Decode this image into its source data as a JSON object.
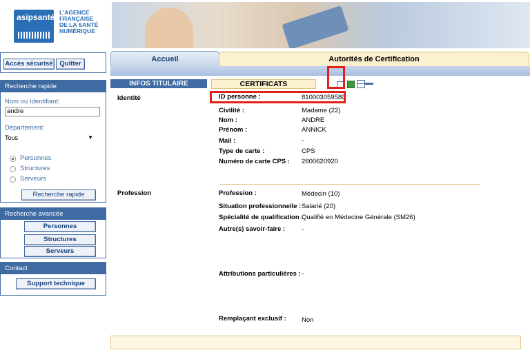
{
  "header": {
    "logo_text": "asipsanté",
    "agency_lines": [
      "L'AGENCE",
      "FRANÇAISE",
      "DE LA SANTÉ",
      "NUMÉRIQUE"
    ]
  },
  "sidebar": {
    "secure_access": "Accès sécurisé",
    "quit": "Quitter",
    "quick_search": {
      "title": "Recherche rapide",
      "name_label": "Nom ou Identifiant:",
      "name_value": "andre",
      "dept_label": "Département:",
      "dept_value": "Tous",
      "radios": [
        "Personnes",
        "Structures",
        "Serveurs"
      ],
      "selected": "Personnes",
      "button": "Recherche rapide"
    },
    "advanced_search": {
      "title": "Recherche avancée",
      "buttons": [
        "Personnes",
        "Structures",
        "Serveurs"
      ]
    },
    "contact": {
      "title": "Contact",
      "button": "Support technique"
    }
  },
  "tabs": {
    "home": "Accueil",
    "authorities": "Autorités de Certification",
    "infos": "INFOS TITULAIRE",
    "certs": "CERTIFICATS"
  },
  "identity": {
    "section": "Identité",
    "rows": [
      {
        "label": "ID personne :",
        "value": "810003059580"
      },
      {
        "label": "Civilité :",
        "value": "Madame (22)"
      },
      {
        "label": "Nom :",
        "value": "ANDRE"
      },
      {
        "label": "Prénom :",
        "value": "ANNICK"
      },
      {
        "label": "Mail :",
        "value": "-"
      },
      {
        "label": "Type de carte :",
        "value": "CPS"
      },
      {
        "label": "Numéro de carte CPS :",
        "value": "2600620920"
      }
    ]
  },
  "profession": {
    "section": "Profession",
    "rows": [
      {
        "label": "Profession :",
        "value": "Médecin (10)"
      },
      {
        "label": "Situation professionnelle :",
        "value": "Salarié (20)"
      },
      {
        "label": "Spécialité de qualification :",
        "value": "Qualifié en Médecine Générale (SM26)"
      },
      {
        "label": "Autre(s) savoir-faire :",
        "value": "-"
      },
      {
        "label": "Attributions particulières :",
        "value": "-"
      },
      {
        "label": "Remplaçant exclusif :",
        "value": "Non"
      }
    ]
  },
  "colors": {
    "accent": "#3f6ba3",
    "highlight": "#e0201a",
    "tab_yellow": "#fbf1cf"
  }
}
